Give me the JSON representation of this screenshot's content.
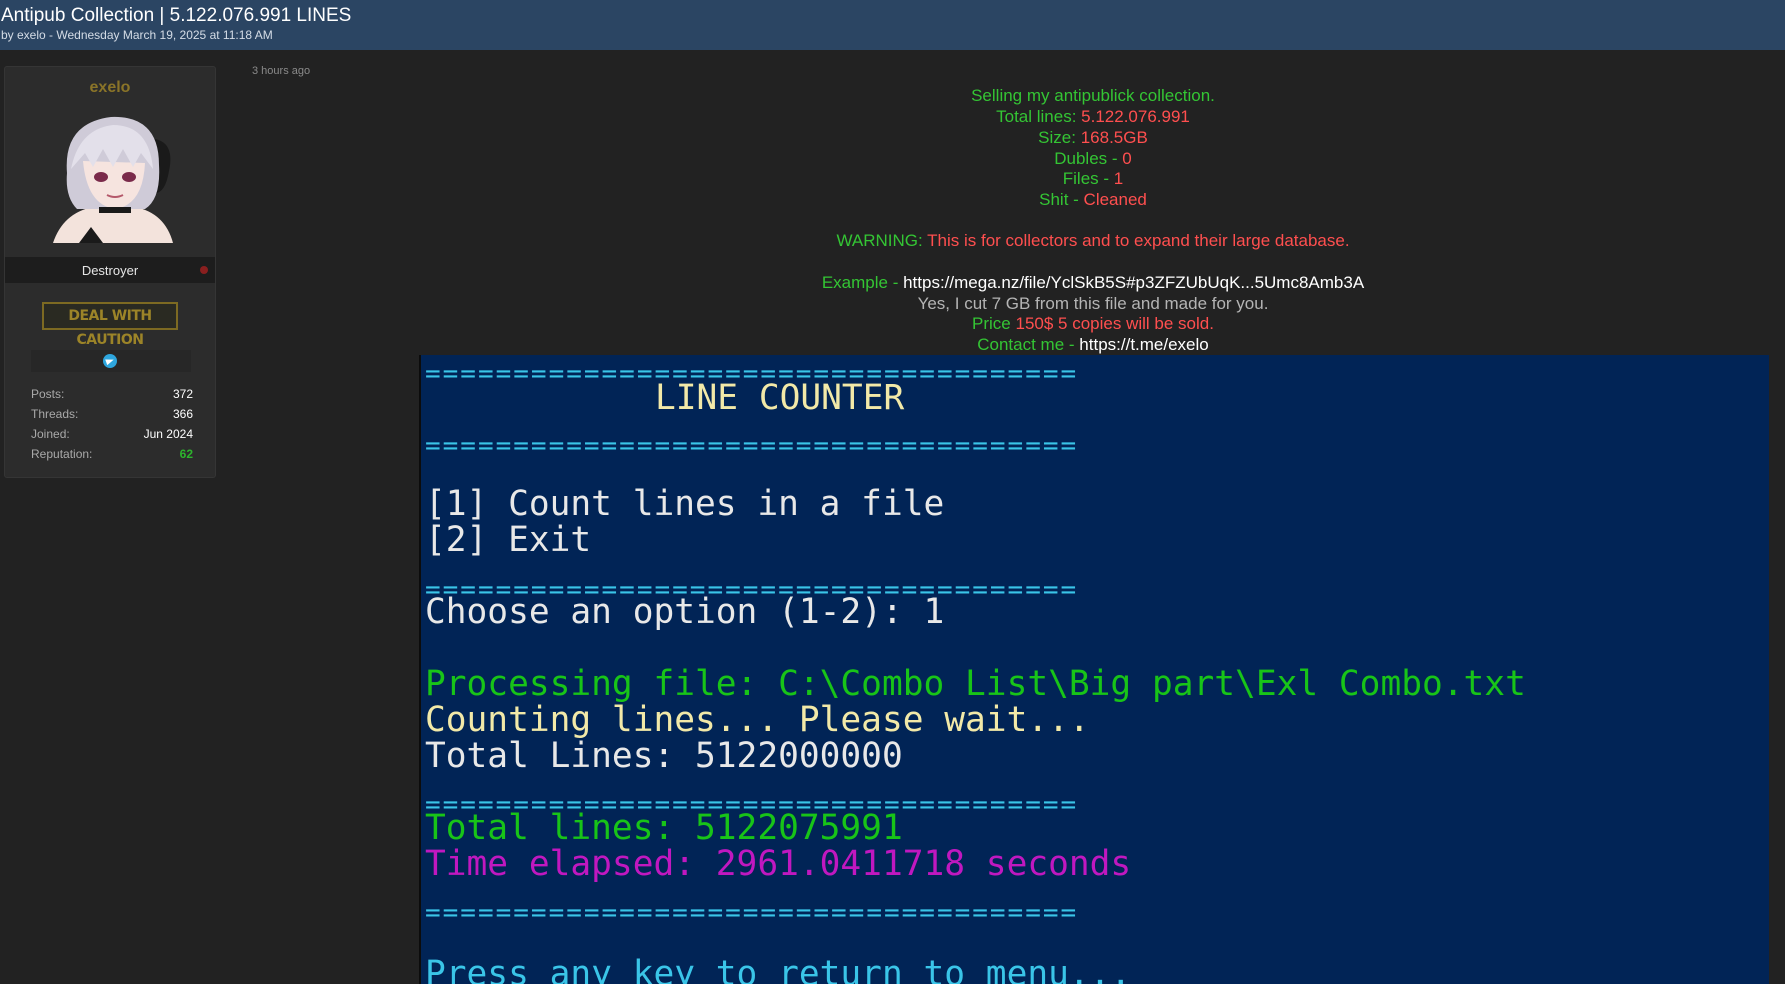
{
  "thread": {
    "title": "Antipub Collection | 5.122.076.991 LINES",
    "byline": "by exelo - Wednesday March 19, 2025 at 11:18 AM"
  },
  "user": {
    "username": "exelo",
    "rank": "Destroyer",
    "badge": "DEAL WITH CAUTION",
    "stats": [
      {
        "label": "Posts:",
        "value": "372"
      },
      {
        "label": "Threads:",
        "value": "366"
      },
      {
        "label": "Joined:",
        "value": "Jun 2024"
      },
      {
        "label": "Reputation:",
        "value": "62"
      }
    ]
  },
  "post": {
    "timestamp": "3 hours ago",
    "intro": "Selling my antipublick collection.",
    "total_lines_label": "Total lines:",
    "total_lines_value": "5.122.076.991",
    "size_label": "Size:",
    "size_value": "168.5GB",
    "dubles_label": "Dubles -",
    "dubles_value": "0",
    "files_label": "Files -",
    "files_value": "1",
    "shit_label": "Shit -",
    "shit_value": "Cleaned",
    "warning_label": "WARNING:",
    "warning_text": "This is for collectors and to expand their large database.",
    "example_label": "Example -",
    "example_link": "https://mega.nz/file/YclSkB5S#p3ZFZUbUqK...5Umc8Amb3A",
    "cut_note": "Yes, I cut 7 GB from this file and made  for you.",
    "price_label": "Price",
    "price_text": "150$ 5 copies will be sold.",
    "contact_label": "Contact me -",
    "contact_link": "https://t.me/exelo"
  },
  "console": {
    "separator": "=====================================",
    "header": "LINE COUNTER",
    "option1": "[1] Count lines in a file",
    "option2": "[2] Exit",
    "choose": "Choose an option (1-2): 1",
    "processing": "Processing file: C:\\Combo List\\Big part\\Exl Combo.txt",
    "counting": "Counting lines... Please wait...",
    "total_lines_estimate": "Total Lines: 5122000000",
    "total_lines": "Total lines: 5122075991",
    "time_elapsed": "Time elapsed: 2961.0411718 seconds",
    "press_key": "Press any key to return to menu..."
  },
  "colors": {
    "topbar": "#2b4563",
    "background": "#222222",
    "console_bg": "#012456",
    "green": "#34c534",
    "red": "#ff4f4f"
  },
  "icons": [
    "telegram-icon",
    "status-dot-icon"
  ]
}
